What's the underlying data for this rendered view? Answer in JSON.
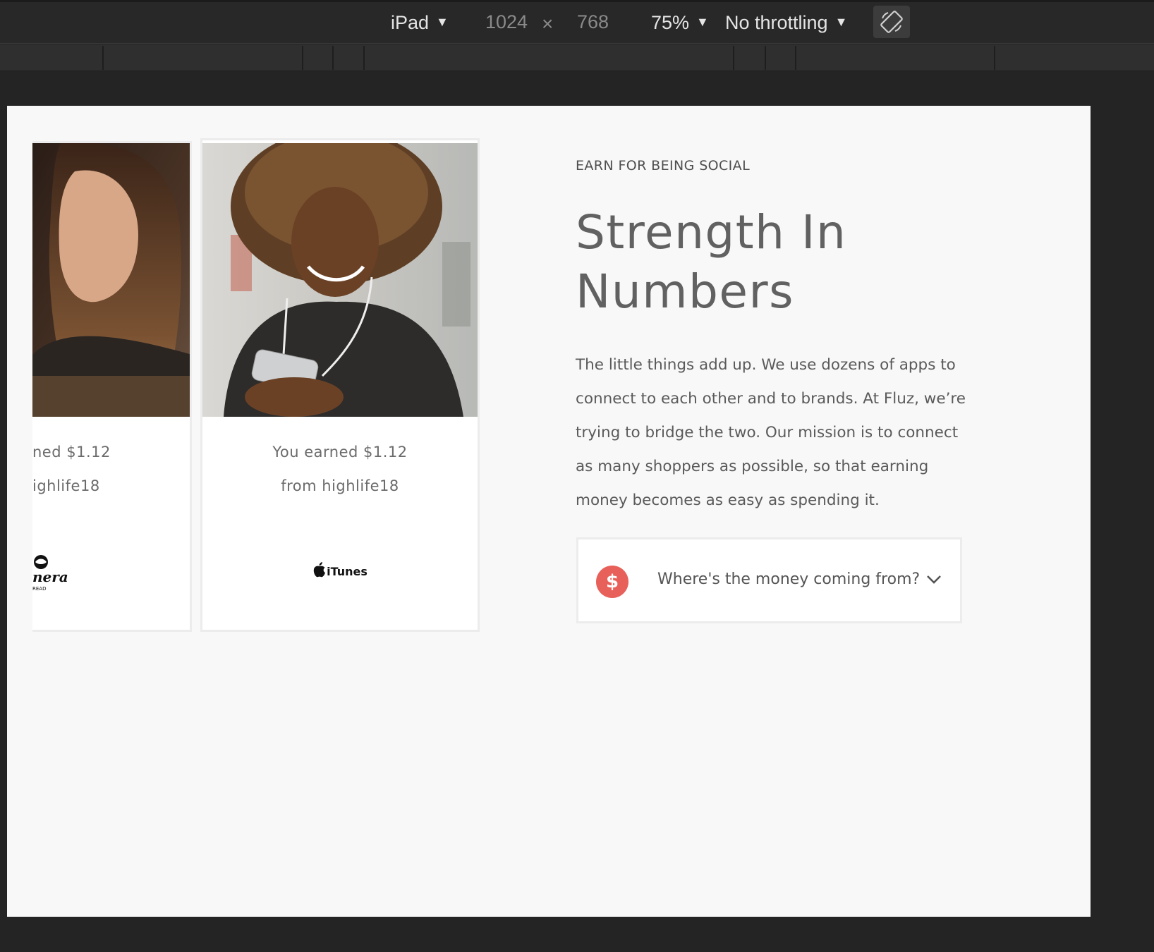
{
  "devtools": {
    "device": "iPad",
    "width": "1024",
    "times": "×",
    "height": "768",
    "zoom": "75%",
    "throttling": "No throttling",
    "caret": "▼",
    "rotate_icon": "rotate-device-icon"
  },
  "page": {
    "cards": [
      {
        "caption_line1": "ned $1.12",
        "caption_line2": "ighlife18",
        "brand_logo": "panera-logo",
        "logo_text_main": "nera",
        "logo_text_sub": "READ"
      },
      {
        "caption_line1": "You earned $1.12",
        "caption_line2": "from highlife18",
        "brand_logo": "itunes-logo",
        "logo_text_main": "iTunes",
        "logo_glyph": ""
      }
    ],
    "eyebrow": "EARN FOR BEING SOCIAL",
    "headline_line1": "Strength In",
    "headline_line2": "Numbers",
    "body_lines": [
      "The little things add up. We use dozens of apps to",
      "connect to each other and to brands. At Fluz, we’re",
      "trying to bridge the two. Our mission is to connect",
      "as many shoppers as possible, so that earning",
      "money becomes as easy as spending it."
    ],
    "faq": {
      "icon_symbol": "$",
      "question": "Where's the money coming from?"
    }
  },
  "colors": {
    "accent": "#e8605a",
    "background": "#f8f8f8",
    "devtools_bg": "#282828"
  }
}
